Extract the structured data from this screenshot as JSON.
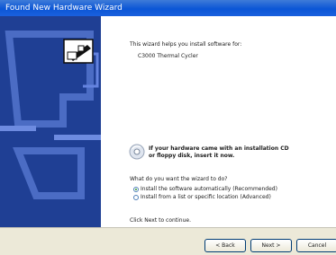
{
  "window": {
    "title": "Found New Hardware Wizard"
  },
  "main": {
    "intro_text": "This wizard helps you install software for:",
    "device_name": "C3000 Thermal Cycler",
    "cd_hint_line1": "If your hardware came with an installation CD",
    "cd_hint_line2": "or floppy disk, insert it now.",
    "question": "What do you want the wizard to do?",
    "options": [
      {
        "label": "Install the software automatically (Recommended)",
        "selected": true
      },
      {
        "label": "Install from a list or specific location (Advanced)",
        "selected": false
      }
    ],
    "continue_text": "Click Next to continue."
  },
  "buttons": {
    "back": "< Back",
    "next": "Next >",
    "cancel": "Cancel"
  }
}
